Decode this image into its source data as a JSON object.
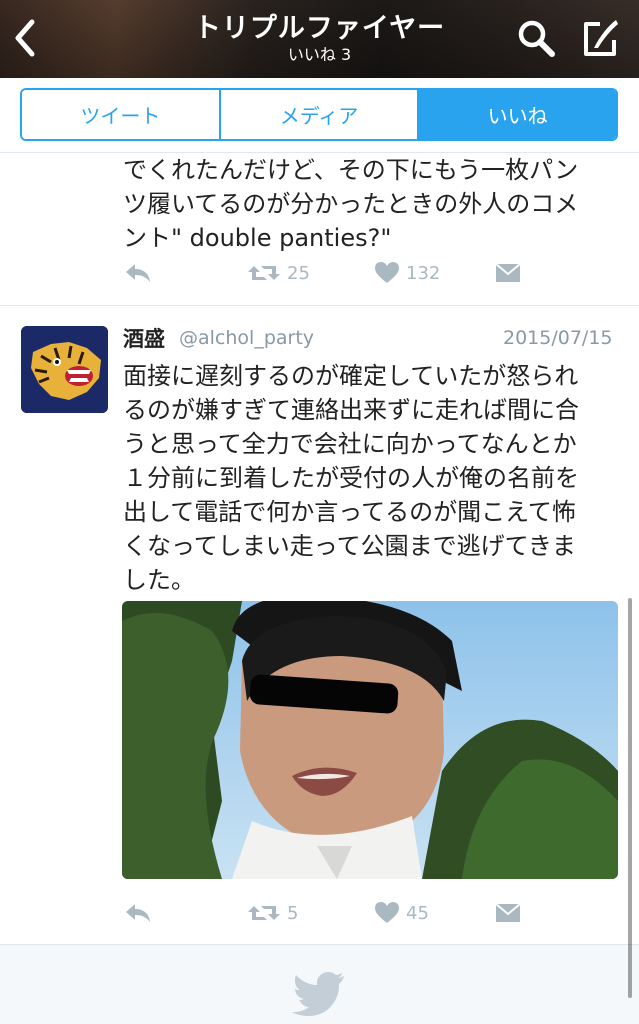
{
  "header": {
    "title": "トリプルファイヤー",
    "subtitle": "いいね 3"
  },
  "tabs": [
    {
      "label": "ツイート",
      "active": false
    },
    {
      "label": "メディア",
      "active": false
    },
    {
      "label": "いいね",
      "active": true
    }
  ],
  "tweets": [
    {
      "text": "でくれたんだけど、その下にもう一枚パン\nツ履いてるのが分かったときの外人のコメ\nント\" double panties?\"",
      "retweets": "25",
      "likes": "132"
    },
    {
      "author_name": "酒盛",
      "author_handle": "@alchol_party",
      "date": "2015/07/15",
      "text": "面接に遅刻するのが確定していたが怒られ\nるのが嫌すぎて連絡出来ずに走れば間に合\nうと思って全力で会社に向かってなんとか\n１分前に到着したが受付の人が俺の名前を\n出して電話で何か言ってるのが聞こえて怖\nくなってしまい走って公園まで逃げてきま\nした。",
      "retweets": "5",
      "likes": "45"
    }
  ],
  "colors": {
    "accent": "#2aa3ef",
    "muted": "#aab8c2",
    "text": "#222222"
  },
  "icons": {
    "back": "chevron-left-icon",
    "search": "search-icon",
    "compose": "compose-icon",
    "reply": "reply-icon",
    "retweet": "retweet-icon",
    "like": "heart-icon",
    "dm": "envelope-icon",
    "footer": "twitter-bird-icon"
  }
}
